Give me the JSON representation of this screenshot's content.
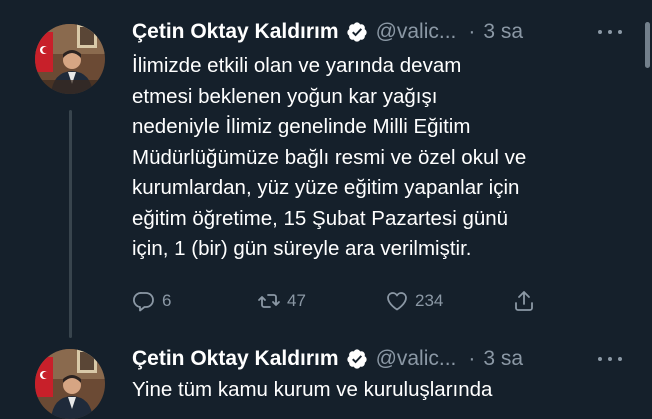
{
  "tweets": [
    {
      "author_name": "Çetin Oktay Kaldırım",
      "handle": "@valic...",
      "separator": "·",
      "time": "3 sa",
      "lines": [
        "İlimizde etkili olan ve yarında devam",
        "etmesi beklenen yoğun kar yağışı",
        "nedeniyle İlimiz genelinde Milli Eğitim",
        "Müdürlüğümüze bağlı resmi ve özel okul ve",
        "kurumlardan, yüz yüze eğitim yapanlar için",
        "eğitim öğretime, 15 Şubat Pazartesi günü",
        "için, 1 (bir) gün süreyle ara verilmiştir."
      ],
      "actions": {
        "reply_count": "6",
        "retweet_count": "47",
        "like_count": "234"
      }
    },
    {
      "author_name": "Çetin Oktay Kaldırım",
      "handle": "@valic...",
      "separator": "·",
      "time": "3 sa",
      "lines": [
        "Yine tüm kamu kurum ve kuruluşlarında"
      ]
    }
  ],
  "colors": {
    "background": "#15202b",
    "secondary_text": "#8b98a5",
    "verified_badge": "#ffffff",
    "thread_line": "#38444d"
  },
  "icons": {
    "verified": "verified-badge-icon",
    "more": "more-dots-icon",
    "reply": "reply-icon",
    "retweet": "retweet-icon",
    "like": "heart-icon",
    "share": "share-icon"
  }
}
